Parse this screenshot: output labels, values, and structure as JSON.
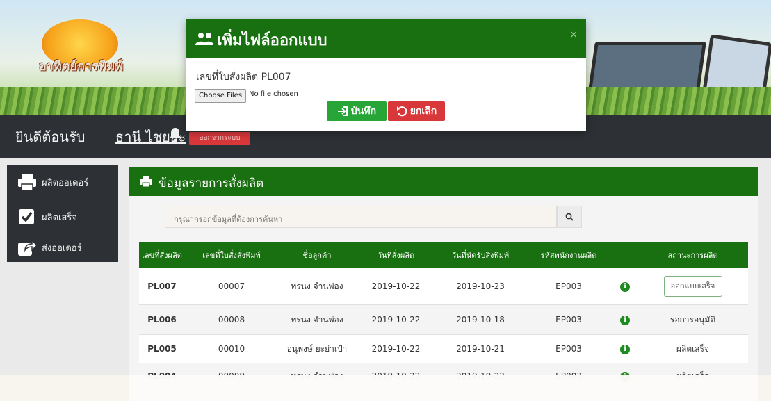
{
  "banner": {
    "logo_text": "อาทิตย์การพิมพ์"
  },
  "welcome": {
    "greeting": "ยินดีต้อนรับ",
    "user_name": "ธานี ไชยยะ",
    "logout_label": "ออกจากระบบ"
  },
  "sidebar": {
    "items": [
      {
        "label": "ผลิตออเดอร์",
        "icon": "printer-icon"
      },
      {
        "label": "ผลิตเสร็จ",
        "icon": "checkbox-icon"
      },
      {
        "label": "ส่งออเดอร์",
        "icon": "share-icon"
      }
    ]
  },
  "panel": {
    "title": "ข้อมูลรายการสั่งผลิต",
    "search_placeholder": "กรุณากรอกข้อมูลที่ต้องการค้นหา"
  },
  "table": {
    "headers": [
      "เลขที่สั่งผลิต",
      "เลขที่ใบสั่งสั่งพิมพ์",
      "ชื่อลูกค้า",
      "วันที่สั่งผลิต",
      "วันที่นัดรับสิ่งพิมพ์",
      "รหัสพนักงานผลิต",
      "",
      "สถานะการผลิต"
    ],
    "rows": [
      {
        "id": "PL007",
        "order": "00007",
        "customer": "ทรนง จำนพ่อง",
        "order_date": "2019-10-22",
        "pickup_date": "2019-10-23",
        "employee": "EP003",
        "status": "ออกแบบเสร็จ"
      },
      {
        "id": "PL006",
        "order": "00008",
        "customer": "ทรนง จำนพ่อง",
        "order_date": "2019-10-22",
        "pickup_date": "2019-10-18",
        "employee": "EP003",
        "status": "รอการอนุมัติ"
      },
      {
        "id": "PL005",
        "order": "00010",
        "customer": "อนุพงษ์ ยะย่าเป้า",
        "order_date": "2019-10-22",
        "pickup_date": "2019-10-21",
        "employee": "EP003",
        "status": "ผลิตเสร็จ"
      },
      {
        "id": "PL004",
        "order": "00009",
        "customer": "ทรนง จำนพ่อง",
        "order_date": "2019-10-22",
        "pickup_date": "2019-10-22",
        "employee": "EP003",
        "status": "ผลิตเสร็จ"
      }
    ]
  },
  "modal": {
    "title": "เพิ่มไฟล์ออกแบบ",
    "close": "×",
    "order_label": "เลขที่ใบสั่งผลิต PL007",
    "file_button": "Choose Files",
    "file_status": "No file chosen",
    "save_label": "บันทึก",
    "cancel_label": "ยกเลิก"
  },
  "colors": {
    "primary_green": "#187010",
    "button_green": "#27a637",
    "danger_red": "#d9383b",
    "dark_bar": "#2d3034"
  }
}
